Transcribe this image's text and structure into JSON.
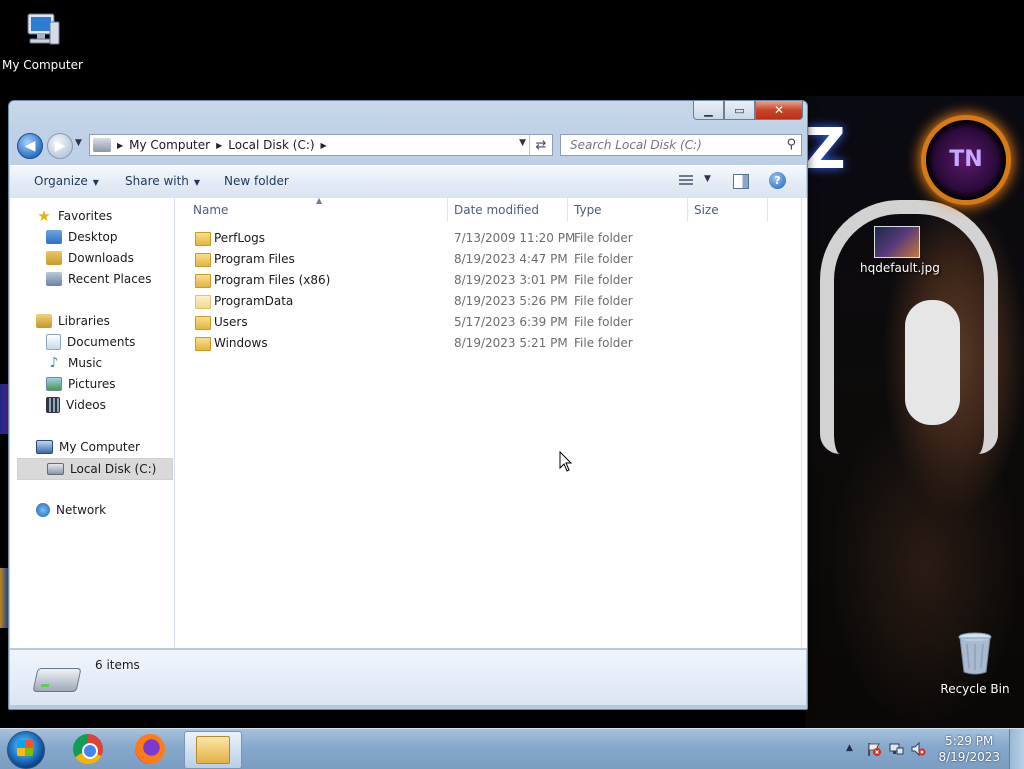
{
  "desktop": {
    "icons": {
      "my_computer": "My Computer",
      "hqdefault": "hqdefault.jpg",
      "recycle_bin": "Recycle Bin"
    },
    "wallpaper_badge": "TN"
  },
  "window": {
    "caption": {
      "minimize": "▁",
      "maximize": "▭",
      "close": "✕"
    },
    "address": {
      "crumbs": [
        "My Computer",
        "Local Disk (C:)"
      ]
    },
    "search": {
      "placeholder": "Search Local Disk (C:)"
    },
    "toolbar": {
      "organize": "Organize",
      "share_with": "Share with",
      "new_folder": "New folder"
    },
    "nav": {
      "favorites": "Favorites",
      "desktop": "Desktop",
      "downloads": "Downloads",
      "recent_places": "Recent Places",
      "libraries": "Libraries",
      "documents": "Documents",
      "music": "Music",
      "pictures": "Pictures",
      "videos": "Videos",
      "my_computer": "My Computer",
      "local_disk": "Local Disk (C:)",
      "network": "Network"
    },
    "columns": {
      "name": "Name",
      "date_modified": "Date modified",
      "type": "Type",
      "size": "Size"
    },
    "files": [
      {
        "name": "PerfLogs",
        "date": "7/13/2009 11:20 PM",
        "type": "File folder"
      },
      {
        "name": "Program Files",
        "date": "8/19/2023 4:47 PM",
        "type": "File folder"
      },
      {
        "name": "Program Files (x86)",
        "date": "8/19/2023 3:01 PM",
        "type": "File folder"
      },
      {
        "name": "ProgramData",
        "date": "8/19/2023 5:26 PM",
        "type": "File folder"
      },
      {
        "name": "Users",
        "date": "5/17/2023 6:39 PM",
        "type": "File folder"
      },
      {
        "name": "Windows",
        "date": "8/19/2023 5:21 PM",
        "type": "File folder"
      }
    ],
    "details": {
      "item_count": "6 items"
    }
  },
  "taskbar": {
    "clock": {
      "time": "5:29 PM",
      "date": "8/19/2023"
    },
    "tray_expand": "▲"
  },
  "colors": {
    "taskbar": "#86a8ca",
    "window_frame": "#bfd1e6",
    "selection": "#d9d9d9"
  }
}
